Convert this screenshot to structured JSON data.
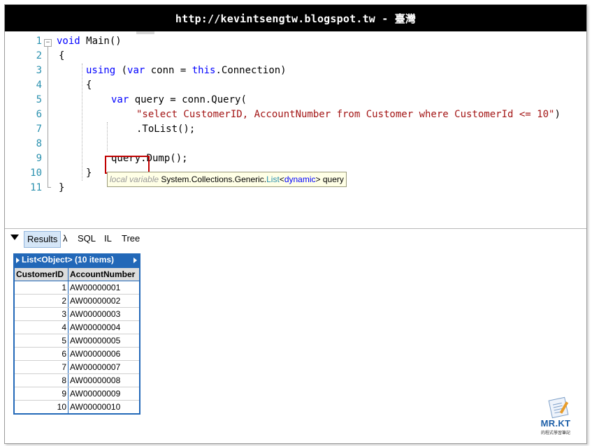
{
  "banner": {
    "text": "http://kevintsengtw.blogspot.tw - 臺灣"
  },
  "editor": {
    "line_numbers": [
      "1",
      "2",
      "3",
      "4",
      "5",
      "6",
      "7",
      "8",
      "9",
      "10",
      "11"
    ],
    "code": {
      "l1": {
        "kw": "void",
        "rest": " Main()"
      },
      "l2": "{",
      "l3": {
        "kw1": "using",
        "p1": " (",
        "kw2": "var",
        "p2": " conn = ",
        "kw3": "this",
        "p3": ".Connection)"
      },
      "l4": "{",
      "l5": {
        "kw": "var",
        "rest": " query = conn.Query("
      },
      "l6": {
        "str": "\"select CustomerID, AccountNumber from Customer where CustomerId <= 10\"",
        "rest": ")"
      },
      "l7": ".ToList();",
      "l8": "",
      "l9": {
        "a": "query.",
        "b": "Dump();"
      },
      "l10": "}",
      "l11": "}"
    },
    "tooltip": {
      "prefix": "local variable",
      "type_ns": "System.Collections.Generic.",
      "type_name": "List",
      "lt": "<",
      "generic": "dynamic",
      "gt": ">",
      "name": " query"
    }
  },
  "results_tabs": [
    "Results",
    "λ",
    "SQL",
    "IL",
    "Tree"
  ],
  "results": {
    "title": "List<Object> (10 items)",
    "columns": [
      "CustomerID",
      "AccountNumber"
    ],
    "rows": [
      [
        "1",
        "AW00000001"
      ],
      [
        "2",
        "AW00000002"
      ],
      [
        "3",
        "AW00000003"
      ],
      [
        "4",
        "AW00000004"
      ],
      [
        "5",
        "AW00000005"
      ],
      [
        "6",
        "AW00000006"
      ],
      [
        "7",
        "AW00000007"
      ],
      [
        "8",
        "AW00000008"
      ],
      [
        "9",
        "AW00000009"
      ],
      [
        "10",
        "AW00000010"
      ]
    ]
  },
  "logo": {
    "brand": "MR.KT",
    "sub": "的程式學習筆記"
  },
  "colors": {
    "keyword": "#0000ff",
    "string": "#a31515",
    "line_number": "#2b91af",
    "highlight": "#c00000",
    "results_header": "#2268b8"
  }
}
